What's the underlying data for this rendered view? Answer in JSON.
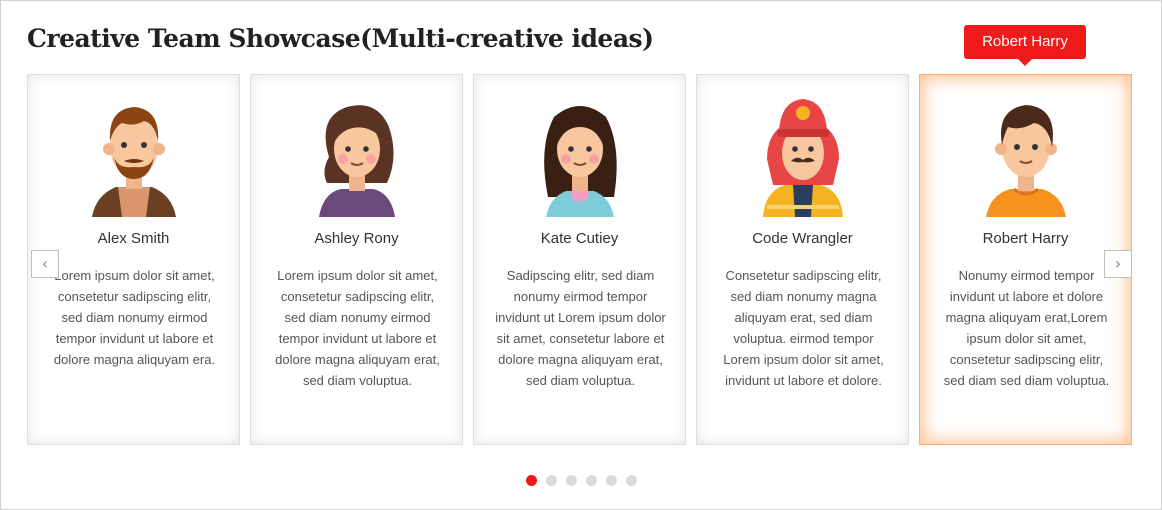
{
  "title": "Creative Team Showcase(Multi-creative ideas)",
  "tooltip": "Robert Harry",
  "members": [
    {
      "name": "Alex Smith",
      "avatar": "bearded-man-avatar-icon",
      "bio": "Lorem ipsum dolor sit amet, consetetur sadipscing elitr, sed diam nonumy eirmod tempor invidunt ut labore et dolore magna aliquyam era."
    },
    {
      "name": "Ashley Rony",
      "avatar": "woman-avatar-icon",
      "bio": "Lorem ipsum dolor sit amet, consetetur sadipscing elitr, sed diam nonumy eirmod tempor invidunt ut labore et dolore magna aliquyam erat, sed diam voluptua."
    },
    {
      "name": "Kate Cutiey",
      "avatar": "girl-avatar-icon",
      "bio": "Sadipscing elitr, sed diam nonumy eirmod tempor invidunt ut Lorem ipsum dolor sit amet, consetetur labore et dolore magna aliquyam erat, sed diam voluptua."
    },
    {
      "name": "Code Wrangler",
      "avatar": "firefighter-avatar-icon",
      "bio": "Consetetur sadipscing elitr, sed diam nonumy magna aliquyam erat, sed diam voluptua. eirmod tempor Lorem ipsum dolor sit amet, invidunt ut labore et dolore."
    },
    {
      "name": "Robert Harry",
      "avatar": "boy-avatar-icon",
      "bio": "Nonumy eirmod tempor invidunt ut labore et dolore magna aliquyam erat,Lorem ipsum dolor sit amet, consetetur sadipscing elitr, sed diam sed diam voluptua."
    }
  ],
  "active_index": 4,
  "nav": {
    "prev_glyph": "‹",
    "next_glyph": "›"
  },
  "pagination": {
    "count": 6,
    "active": 0
  },
  "colors": {
    "accent": "#f11a1a",
    "active_glow": "#ff9650"
  }
}
